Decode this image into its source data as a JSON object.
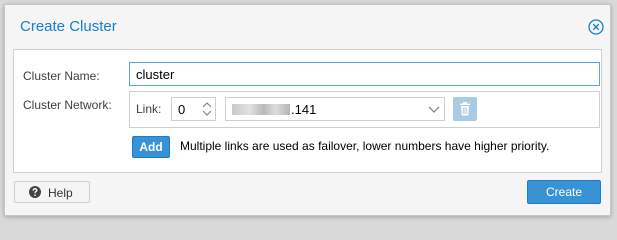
{
  "dialog": {
    "title": "Create Cluster",
    "close_icon": "close-circle-icon"
  },
  "form": {
    "cluster_name_label": "Cluster Name:",
    "cluster_name_value": "cluster",
    "cluster_network_label": "Cluster Network:"
  },
  "links": [
    {
      "label": "Link:",
      "number": "0",
      "address_suffix": ".141",
      "address_obscured": true,
      "remove_icon": "trash-icon"
    }
  ],
  "add_button": {
    "label": "Add"
  },
  "hint": "Multiple links are used as failover, lower numbers have higher priority.",
  "footer": {
    "help_label": "Help",
    "help_icon": "question-circle-icon",
    "create_label": "Create"
  },
  "colors": {
    "accent": "#157fcc",
    "button_primary": "#3892d4",
    "trash_disabled": "#aacbe6"
  }
}
